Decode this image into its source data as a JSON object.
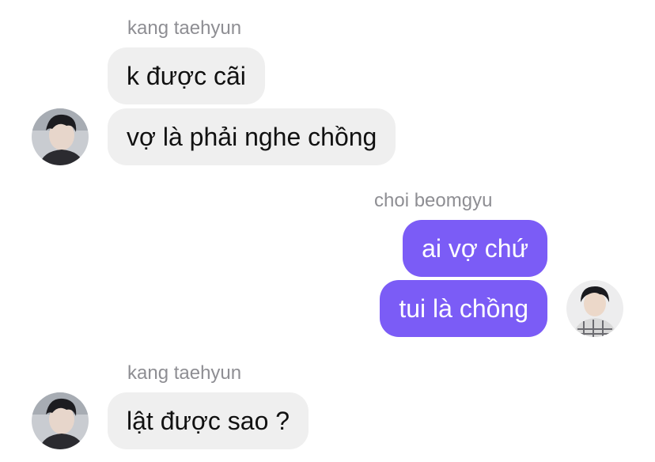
{
  "messages": [
    {
      "sender": "kang taehyun",
      "side": "incoming",
      "text": "k được cãi"
    },
    {
      "sender": "kang taehyun",
      "side": "incoming",
      "text": "vợ là phải nghe chồng"
    },
    {
      "sender": "choi beomgyu",
      "side": "outgoing",
      "text": "ai vợ chứ"
    },
    {
      "sender": "choi beomgyu",
      "side": "outgoing",
      "text": "tui là chồng"
    },
    {
      "sender": "kang taehyun",
      "side": "incoming",
      "text": "lật được sao ?"
    }
  ],
  "groups": [
    {
      "sender": "kang taehyun"
    },
    {
      "sender": "choi beomgyu"
    },
    {
      "sender": "kang taehyun"
    }
  ],
  "colors": {
    "incoming_bubble": "#efefef",
    "outgoing_bubble": "#7b5cf6",
    "sender_name": "#8e8e93"
  }
}
